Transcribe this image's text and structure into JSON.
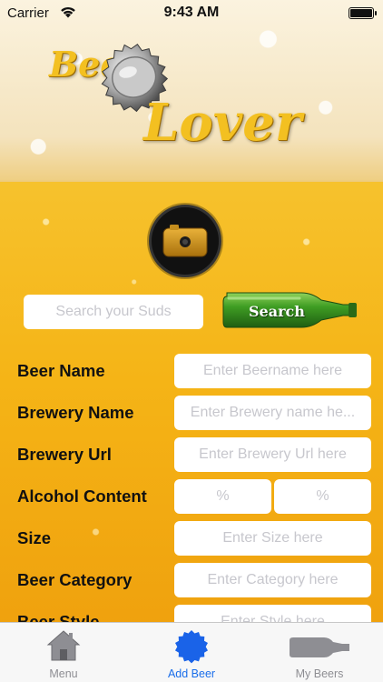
{
  "status_bar": {
    "carrier": "Carrier",
    "time": "9:43 AM"
  },
  "logo": {
    "word_1": "Beer",
    "word_2": "Lover"
  },
  "search": {
    "placeholder": "Search your Suds",
    "button_label": "Search"
  },
  "form": {
    "beer_name": {
      "label": "Beer Name",
      "placeholder": "Enter Beername here"
    },
    "brewery_name": {
      "label": "Brewery Name",
      "placeholder": "Enter Brewery name he..."
    },
    "brewery_url": {
      "label": "Brewery Url",
      "placeholder": "Enter Brewery Url here"
    },
    "alcohol_content": {
      "label": "Alcohol Content",
      "placeholder_1": "%",
      "placeholder_2": "%"
    },
    "size": {
      "label": "Size",
      "placeholder": "Enter Size here"
    },
    "beer_category": {
      "label": "Beer Category",
      "placeholder": "Enter Category here"
    },
    "beer_style": {
      "label": "Beer Style",
      "placeholder": "Enter Style here"
    }
  },
  "tabs": [
    {
      "label": "Menu",
      "icon": "house-icon"
    },
    {
      "label": "Add Beer",
      "icon": "bottle-cap-icon",
      "active": true
    },
    {
      "label": "My Beers",
      "icon": "bottle-icon"
    }
  ],
  "colors": {
    "accent": "#1a6eea",
    "beer": "#f5b416",
    "inactive_tab": "#8e8e93"
  }
}
